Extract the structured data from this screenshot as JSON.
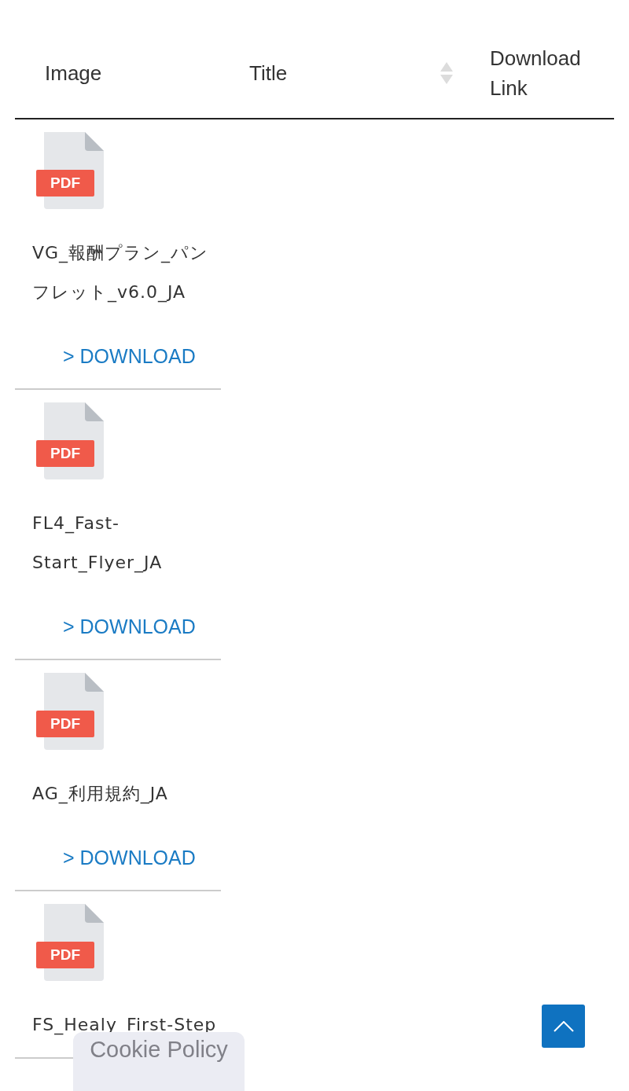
{
  "table": {
    "columns": [
      {
        "label": "Image",
        "sortable": false
      },
      {
        "label": "Title",
        "sortable": true
      },
      {
        "label": "Download Link",
        "sortable": false
      }
    ],
    "rows": [
      {
        "icon_label": "PDF",
        "title": "VG_報酬プラン_パンフレット_v6.0_JA",
        "link": "> DOWNLOAD"
      },
      {
        "icon_label": "PDF",
        "title": "FL4_Fast-Start_Flyer_JA",
        "link": "> DOWNLOAD"
      },
      {
        "icon_label": "PDF",
        "title": "AG_利用規約_JA",
        "link": "> DOWNLOAD"
      },
      {
        "icon_label": "PDF",
        "title": "FS_Healy_First-Step",
        "link": null
      }
    ]
  },
  "cookie_banner": {
    "label": "Cookie Policy"
  },
  "back_to_top": {
    "kind": "chevron-up"
  }
}
